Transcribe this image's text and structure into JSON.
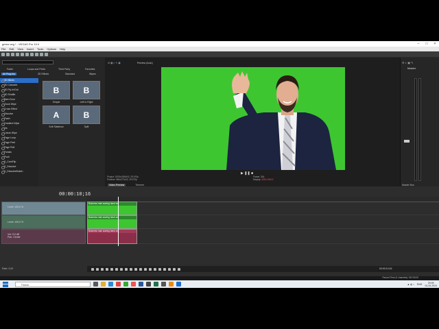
{
  "window": {
    "title": "green.veg * - VEGAS Pro 19.0"
  },
  "menu": [
    "File",
    "Edit",
    "View",
    "Insert",
    "Tools",
    "Options",
    "Help"
  ],
  "fx_panel": {
    "tabs_row1": [
      "Fader",
      "Loops and Peels",
      "Third Party",
      "Favorites"
    ],
    "tabs_row2": [
      "All Plug-Ins",
      "3D Effects",
      "Standard",
      "Wipes"
    ],
    "items": [
      "3D Blinds",
      "3D Cascade",
      "3D Fly In/Out",
      "3D Shuffle",
      "Barn Door",
      "Clock Wipe",
      "Cross Effect",
      "Dissolve",
      "Flash",
      "Gradient Wipe",
      "Iris",
      "Linear Wipe",
      "Page Loop",
      "Page Peel",
      "Page Roll",
      "Portals",
      "Push",
      "S_CamFlip",
      "S_Dissolve",
      "S_DissolveBokeh"
    ],
    "selected": "3D Blinds",
    "thumbs": [
      {
        "letter": "B",
        "label": "Simple"
      },
      {
        "letter": "B",
        "label": "Left to Right"
      },
      {
        "letter": "A",
        "label": "Soft Slatshow"
      },
      {
        "letter": "B",
        "label": "Split"
      }
    ],
    "status": "VEGAS 3D Blinds, OFX, 32-bit floating point",
    "bottom_tabs": [
      "Media",
      "Explorer",
      "Hub Explorer (Beta)",
      "Transitions"
    ]
  },
  "preview": {
    "mode": "Preview (Auto)",
    "info_line1": "Project: 1920x1080x32, 29,970p",
    "info_line2": "Preview: 960x270x32, 29,970p",
    "frame_label": "Frame:",
    "frame_value": "316",
    "display_label": "Display:",
    "display_value": "385x148x32",
    "tabs": [
      "Video Preview",
      "Trimmer"
    ]
  },
  "master": {
    "title": "Master",
    "footer": "Master Bus"
  },
  "timeline": {
    "timecode": "00:00:10;16",
    "tracks": [
      {
        "label": "Level: 100,0 %"
      },
      {
        "label": "Level: 100,0 %"
      },
      {
        "vol_label": "Vol:",
        "vol_value": "0,0 dB",
        "pan_label": "Pan:",
        "pan_value": "Center"
      }
    ],
    "clip_title": "Business man waving hand on",
    "transport_time": "00:00:10;16",
    "rate": "Rate: 0,00",
    "status": "Record Time (2 channels): 912:30:00"
  },
  "taskbar": {
    "search_placeholder": "Поиск",
    "lang": "ENG",
    "time": "23:09",
    "date": "01.04.2024"
  }
}
